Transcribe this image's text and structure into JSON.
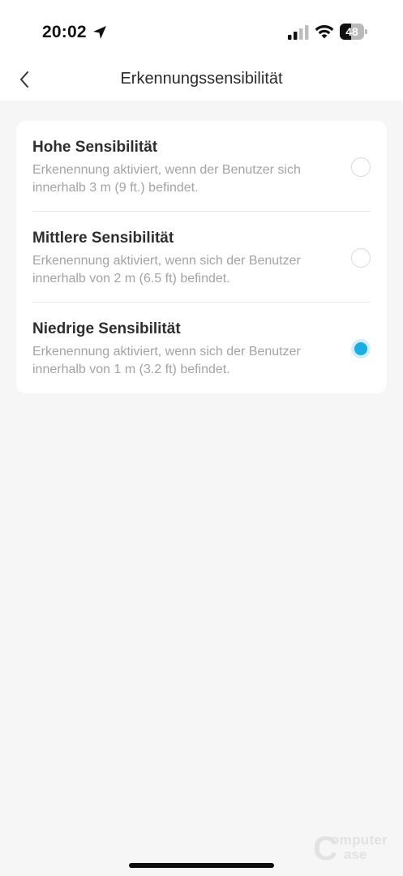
{
  "status_bar": {
    "time": "20:02",
    "battery_level": "48",
    "battery_fraction": 0.48,
    "signal_bars_active": 2,
    "signal_bars_total": 4
  },
  "nav": {
    "title": "Erkennungssensibilität"
  },
  "options": [
    {
      "title": "Hohe Sensibilität",
      "description": "Erkenennung aktiviert, wenn der Benutzer sich innerhalb 3 m (9 ft.) befindet.",
      "selected": false
    },
    {
      "title": "Mittlere Sensibilität",
      "description": "Erkenennung aktiviert, wenn sich der Benutzer innerhalb von 2 m (6.5 ft) befindet.",
      "selected": false
    },
    {
      "title": "Niedrige Sensibilität",
      "description": "Erkenennung aktiviert, wenn sich der Benutzer innerhalb von 1 m (3.2 ft) befindet.",
      "selected": true
    }
  ],
  "watermark": {
    "line1": "omputer",
    "line2": "ase",
    "initial": "C"
  },
  "colors": {
    "accent": "#17aee4",
    "background": "#f6f6f6",
    "card": "#ffffff"
  }
}
